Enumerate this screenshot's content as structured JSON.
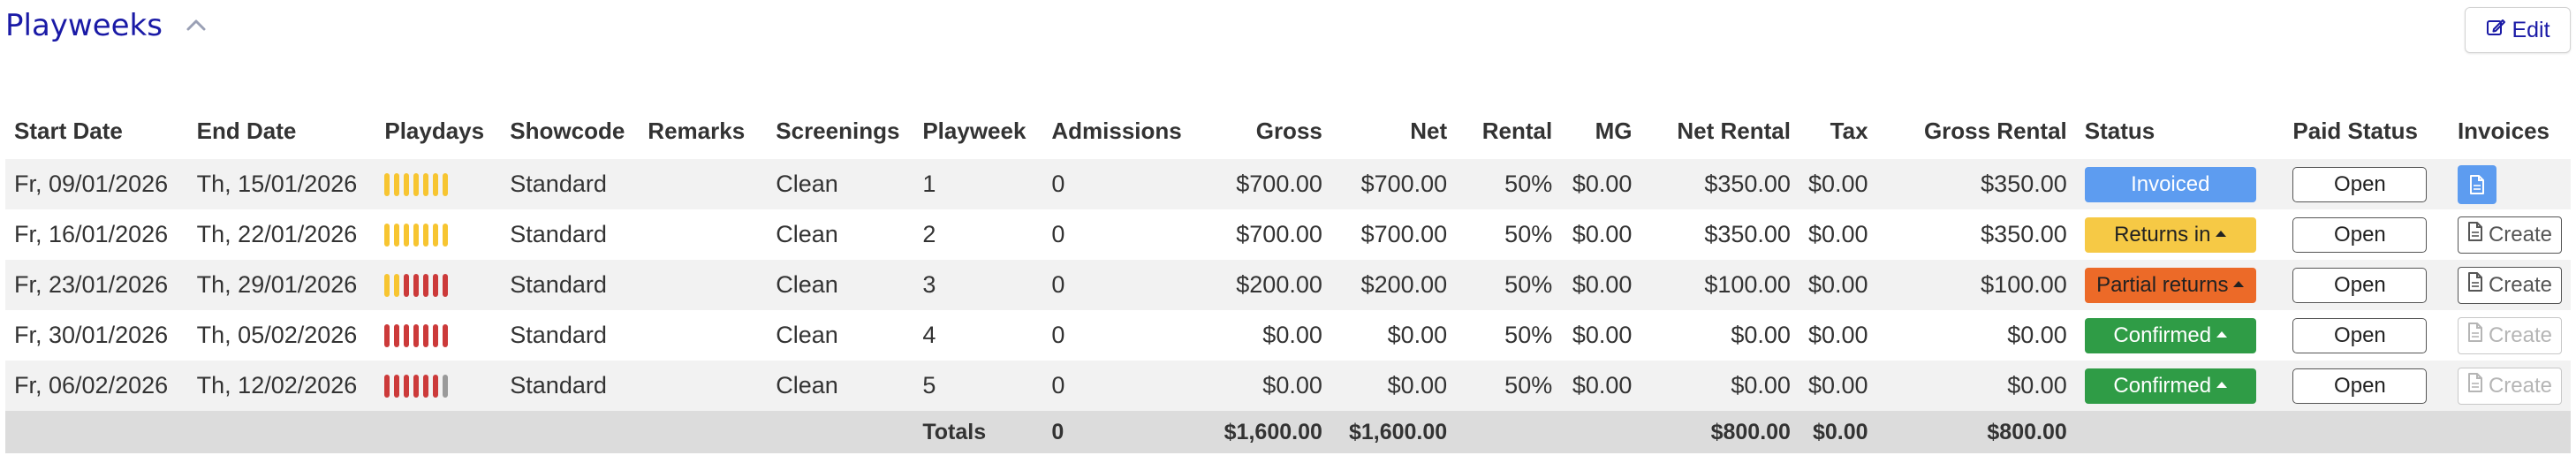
{
  "header": {
    "title": "Playweeks",
    "edit_label": "Edit"
  },
  "columns": [
    "Start Date",
    "End Date",
    "Playdays",
    "Showcode",
    "Remarks",
    "Screenings",
    "Playweek",
    "Admissions",
    "Gross",
    "Net",
    "Rental",
    "MG",
    "Net Rental",
    "Tax",
    "Gross Rental",
    "Status",
    "Paid Status",
    "Invoices"
  ],
  "rows": [
    {
      "start": "Fr, 09/01/2026",
      "end": "Th, 15/01/2026",
      "playdays": [
        "y",
        "y",
        "y",
        "y",
        "y",
        "y",
        "y"
      ],
      "showcode": "Standard",
      "remarks": "",
      "screenings": "Clean",
      "playweek": "1",
      "admissions": "0",
      "gross": "$700.00",
      "net": "$700.00",
      "rental": "50%",
      "mg": "$0.00",
      "net_rental": "$350.00",
      "tax": "$0.00",
      "gross_rental": "$350.00",
      "status": "Invoiced",
      "status_style": "invoiced",
      "status_caret": false,
      "paid": "Open",
      "invoice": "pdf",
      "invoice_label": ""
    },
    {
      "start": "Fr, 16/01/2026",
      "end": "Th, 22/01/2026",
      "playdays": [
        "y",
        "y",
        "y",
        "y",
        "y",
        "y",
        "y"
      ],
      "showcode": "Standard",
      "remarks": "",
      "screenings": "Clean",
      "playweek": "2",
      "admissions": "0",
      "gross": "$700.00",
      "net": "$700.00",
      "rental": "50%",
      "mg": "$0.00",
      "net_rental": "$350.00",
      "tax": "$0.00",
      "gross_rental": "$350.00",
      "status": "Returns in",
      "status_style": "returns",
      "status_caret": true,
      "paid": "Open",
      "invoice": "create",
      "invoice_label": "Create"
    },
    {
      "start": "Fr, 23/01/2026",
      "end": "Th, 29/01/2026",
      "playdays": [
        "y",
        "y",
        "r",
        "r",
        "r",
        "r",
        "r"
      ],
      "showcode": "Standard",
      "remarks": "",
      "screenings": "Clean",
      "playweek": "3",
      "admissions": "0",
      "gross": "$200.00",
      "net": "$200.00",
      "rental": "50%",
      "mg": "$0.00",
      "net_rental": "$100.00",
      "tax": "$0.00",
      "gross_rental": "$100.00",
      "status": "Partial returns",
      "status_style": "partial",
      "status_caret": true,
      "paid": "Open",
      "invoice": "create",
      "invoice_label": "Create"
    },
    {
      "start": "Fr, 30/01/2026",
      "end": "Th, 05/02/2026",
      "playdays": [
        "r",
        "r",
        "r",
        "r",
        "r",
        "r",
        "r"
      ],
      "showcode": "Standard",
      "remarks": "",
      "screenings": "Clean",
      "playweek": "4",
      "admissions": "0",
      "gross": "$0.00",
      "net": "$0.00",
      "rental": "50%",
      "mg": "$0.00",
      "net_rental": "$0.00",
      "tax": "$0.00",
      "gross_rental": "$0.00",
      "status": "Confirmed",
      "status_style": "confirmed",
      "status_caret": true,
      "paid": "Open",
      "invoice": "create-disabled",
      "invoice_label": "Create"
    },
    {
      "start": "Fr, 06/02/2026",
      "end": "Th, 12/02/2026",
      "playdays": [
        "r",
        "r",
        "r",
        "r",
        "r",
        "r",
        "g"
      ],
      "showcode": "Standard",
      "remarks": "",
      "screenings": "Clean",
      "playweek": "5",
      "admissions": "0",
      "gross": "$0.00",
      "net": "$0.00",
      "rental": "50%",
      "mg": "$0.00",
      "net_rental": "$0.00",
      "tax": "$0.00",
      "gross_rental": "$0.00",
      "status": "Confirmed",
      "status_style": "confirmed",
      "status_caret": true,
      "paid": "Open",
      "invoice": "create-disabled",
      "invoice_label": "Create"
    }
  ],
  "totals": {
    "label": "Totals",
    "admissions": "0",
    "gross": "$1,600.00",
    "net": "$1,600.00",
    "net_rental": "$800.00",
    "tax": "$0.00",
    "gross_rental": "$800.00"
  },
  "colors": {
    "accent": "#1a1aa6",
    "playday_yes": "#f7c531",
    "playday_no": "#cc3a3a",
    "playday_none": "#9a9a9a"
  }
}
